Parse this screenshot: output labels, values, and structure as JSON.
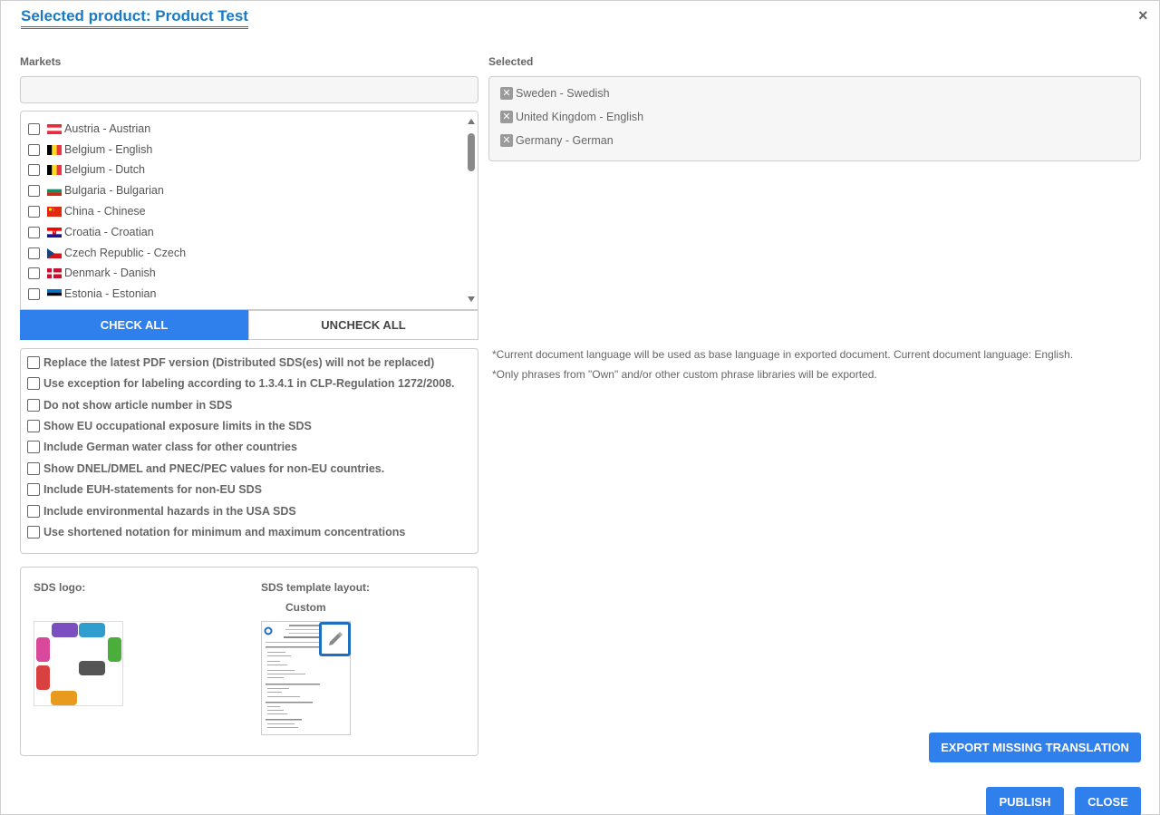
{
  "dialog": {
    "title": "Selected product: Product Test",
    "close_icon": "×"
  },
  "markets": {
    "label": "Markets",
    "search_value": "",
    "items": [
      {
        "label": "Austria - Austrian",
        "flag": "austria"
      },
      {
        "label": "Belgium - English",
        "flag": "belgium"
      },
      {
        "label": "Belgium - Dutch",
        "flag": "belgium"
      },
      {
        "label": "Bulgaria - Bulgarian",
        "flag": "bulgaria"
      },
      {
        "label": "China - Chinese",
        "flag": "china"
      },
      {
        "label": "Croatia - Croatian",
        "flag": "croatia"
      },
      {
        "label": "Czech Republic - Czech",
        "flag": "czech"
      },
      {
        "label": "Denmark - Danish",
        "flag": "denmark"
      },
      {
        "label": "Estonia - Estonian",
        "flag": "estonia"
      }
    ],
    "check_all_label": "CHECK ALL",
    "uncheck_all_label": "UNCHECK ALL"
  },
  "options": [
    "Replace the latest PDF version (Distributed SDS(es) will not be replaced)",
    "Use exception for labeling according to 1.3.4.1 in CLP-Regulation 1272/2008.",
    "Do not show article number in SDS",
    "Show EU occupational exposure limits in the SDS",
    "Include German water class for other countries",
    "Show DNEL/DMEL and PNEC/PEC values for non-EU countries.",
    "Include EUH-statements for non-EU SDS",
    "Include environmental hazards in the USA SDS",
    "Use shortened notation for minimum and maximum concentrations"
  ],
  "sds": {
    "logo_label": "SDS logo:",
    "template_label": "SDS template layout:",
    "template_value": "Custom"
  },
  "selected": {
    "label": "Selected",
    "items": [
      "Sweden - Swedish",
      "United Kingdom - English",
      "Germany - German"
    ]
  },
  "notes": [
    "*Current document language will be used as base language in exported document. Current document language: English.",
    "*Only phrases from \"Own\" and/or other custom phrase libraries will be exported."
  ],
  "actions": {
    "export_missing": "EXPORT MISSING TRANSLATION",
    "publish": "PUBLISH",
    "close": "CLOSE"
  },
  "colors": {
    "accent": "#2f80ed",
    "title": "#1a7bc4"
  }
}
